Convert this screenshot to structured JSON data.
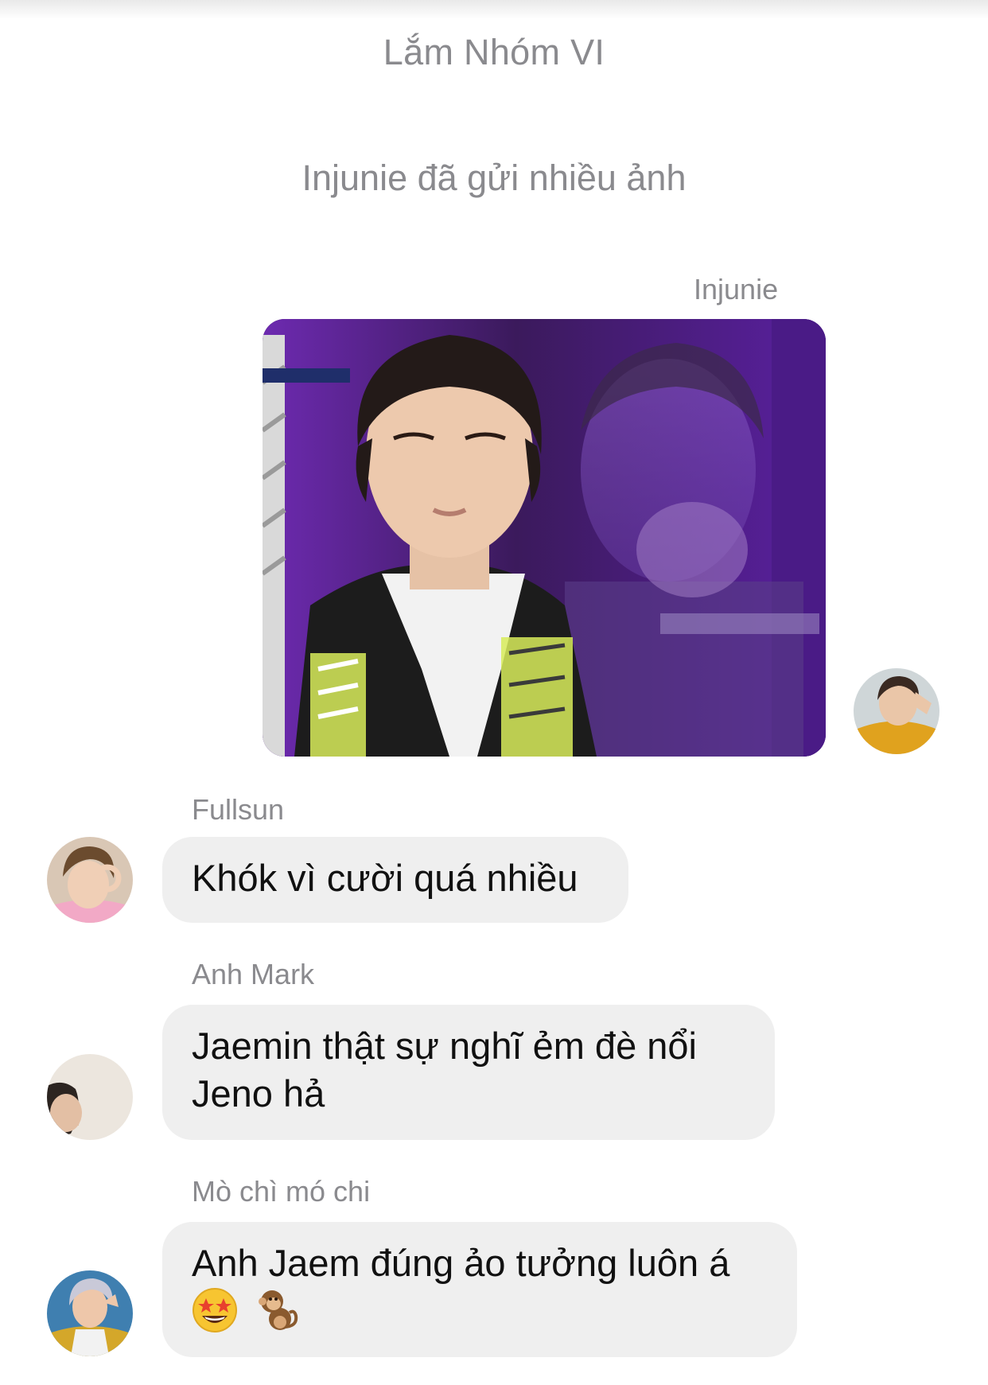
{
  "conversation": {
    "group_name": "Lắm Nhóm VI",
    "system_notice": "Injunie đã gửi nhiều ảnh"
  },
  "messages": [
    {
      "sender": "Injunie",
      "type": "photo",
      "outgoing_side": "right",
      "avatar_icon": "user-avatar-injunie"
    },
    {
      "sender": "Fullsun",
      "type": "text",
      "text": "Khók vì cười quá nhiều",
      "avatar_icon": "user-avatar-fullsun"
    },
    {
      "sender": "Anh Mark",
      "type": "text",
      "text_line1": "Jaemin thật sự nghĩ ẻm đè nổi",
      "text_line2": "Jeno hả",
      "avatar_icon": "user-avatar-anh-mark"
    },
    {
      "sender": "Mò chì mó chi",
      "type": "text",
      "text_line1": "Anh Jaem đúng ảo tưởng luôn á",
      "emojis": [
        "star-struck-emoji",
        "monkey-emoji"
      ],
      "avatar_icon": "user-avatar-mo-chi-mo-chi"
    }
  ],
  "colors": {
    "bubble_background": "#efefef",
    "meta_text": "#8a8a8e",
    "message_text": "#111111"
  }
}
